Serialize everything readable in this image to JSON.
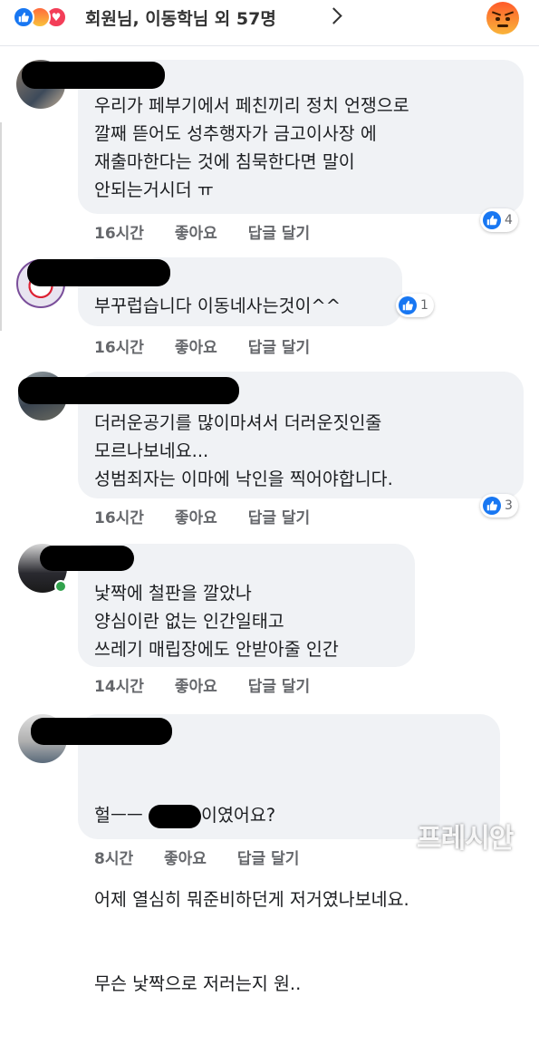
{
  "header": {
    "reaction_icons": [
      "like-icon",
      "angry-icon",
      "love-icon"
    ],
    "title": "회원님, 이동학님 외 57명",
    "chevron": "chevron-right-icon",
    "my_reaction": "angry-icon"
  },
  "comments": [
    {
      "lines": [
        "우리가 페부기에서 페친끼리 정치 언쟁으로",
        "깔째 뜯어도 성추행자가 금고이사장 에",
        "재출마한다는 것에 침묵한다면 말이",
        "안되는거시더 ㅠ"
      ],
      "time": "16시간",
      "like_label": "좋아요",
      "reply_label": "답글 달기",
      "reactions": "4"
    },
    {
      "lines": [
        "부꾸럽습니다 이동네사는것이^^"
      ],
      "time": "16시간",
      "like_label": "좋아요",
      "reply_label": "답글 달기",
      "reactions": "1"
    },
    {
      "lines": [
        "더러운공기를 많이마셔서 더러운짓인줄",
        "모르나보네요...",
        "성범죄자는 이마에 낙인을 찍어야합니다."
      ],
      "time": "16시간",
      "like_label": "좋아요",
      "reply_label": "답글 달기",
      "reactions": "3"
    },
    {
      "lines": [
        "낯짝에 철판을 깔았나",
        "양심이란 없는 인간일태고",
        "쓰레기 매립장에도 안받아줄 인간"
      ],
      "time": "14시간",
      "like_label": "좋아요",
      "reply_label": "답글 달기",
      "online": true
    },
    {
      "line1_prefix": "헐ㅡㅡ ",
      "line1_suffix": "이였어요?",
      "lines": [
        "어제 열심히 뭐준비하던게 저거였나보네요.",
        "무슨 낯짝으로 저러는지 원.."
      ],
      "time": "8시간",
      "like_label": "좋아요",
      "reply_label": "답글 달기"
    }
  ],
  "watermark": "프레시안",
  "colors": {
    "like_blue": "#1877f2",
    "bubble_bg": "#f0f2f5",
    "meta_gray": "#65676b",
    "online_green": "#31a24c"
  }
}
